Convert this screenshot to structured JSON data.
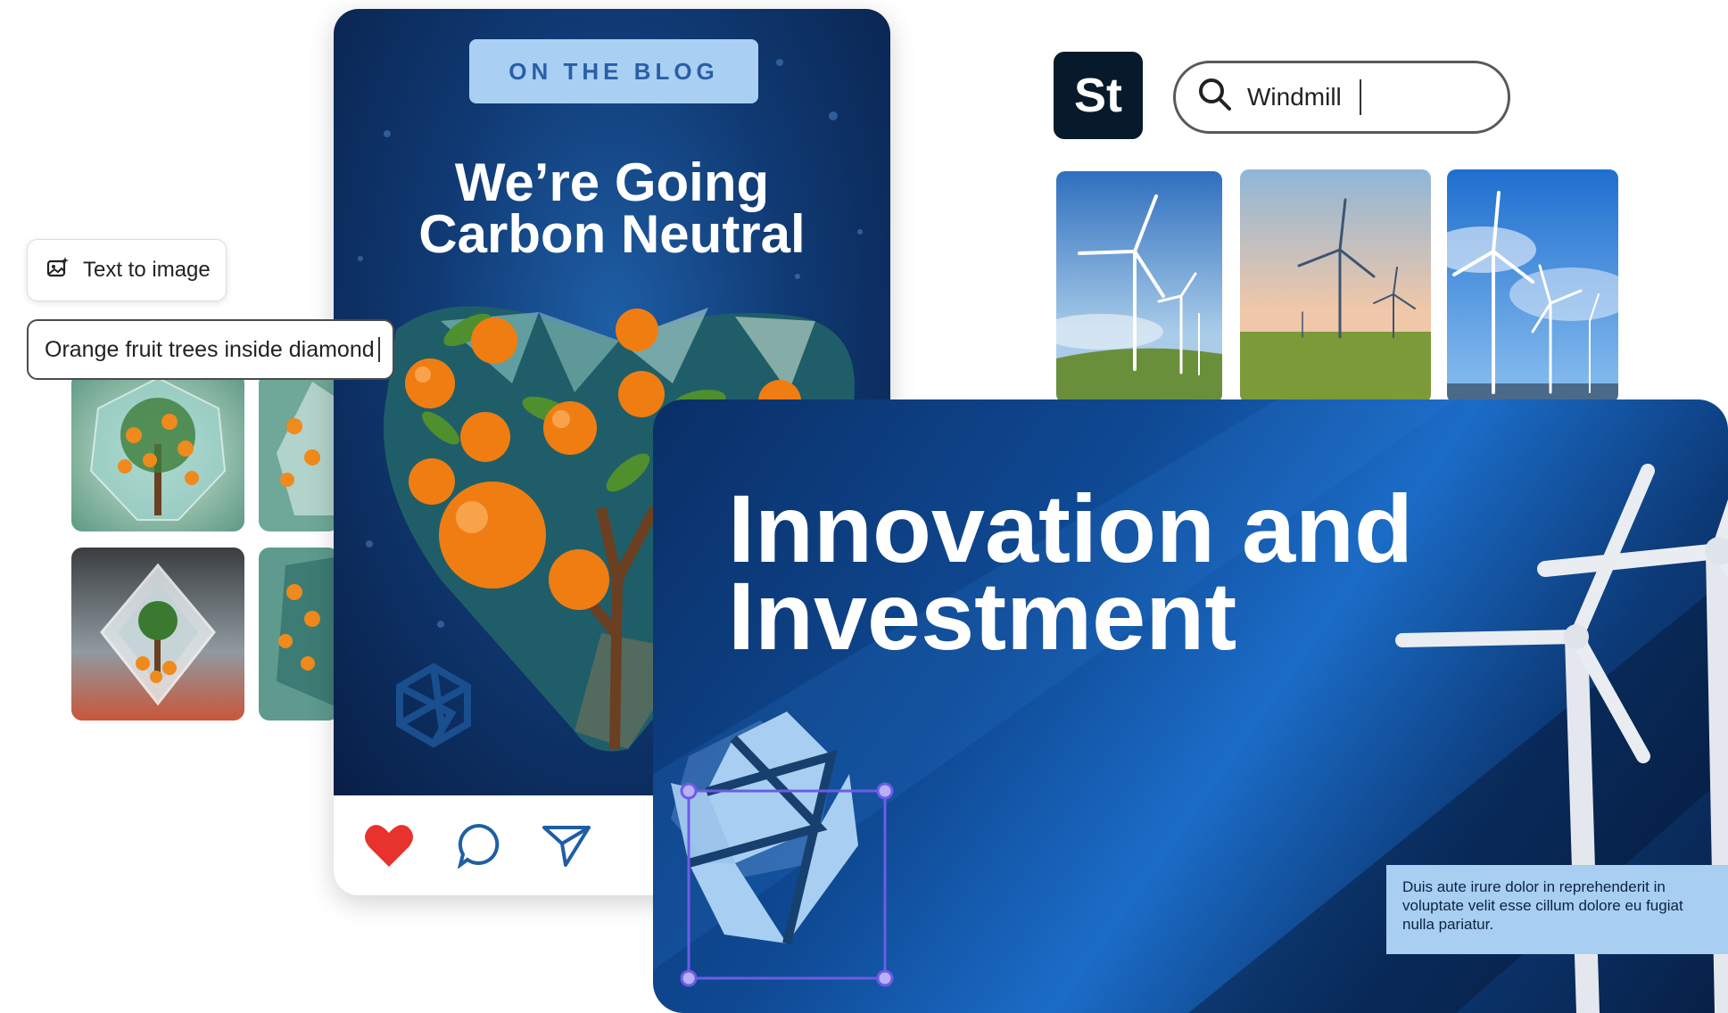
{
  "text_to_image": {
    "chip_label": "Text to image",
    "prompt_value": "Orange fruit trees inside diamond"
  },
  "post": {
    "badge": "ON THE BLOG",
    "title_line1": "We’re Going",
    "title_line2": "Carbon Neutral",
    "actions": [
      "like",
      "comment",
      "share"
    ]
  },
  "stock": {
    "logo": "St",
    "search_value": "Windmill"
  },
  "slide": {
    "title_line1": "Innovation and",
    "title_line2": "Investment",
    "caption": "Duis aute irure dolor in reprehenderit in voluptate velit esse cillum dolore eu fugiat nulla pariatur."
  },
  "colors": {
    "brand_blue": "#1b6cc7",
    "pill_blue": "#a9d0f3",
    "heart_red": "#e8322d",
    "selection_purple": "#6d5ce6"
  }
}
